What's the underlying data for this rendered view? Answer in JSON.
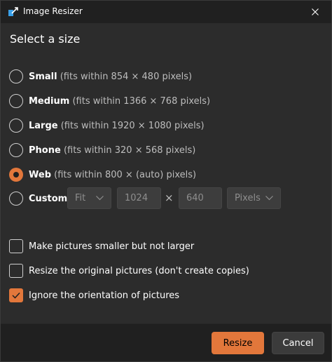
{
  "window": {
    "title": "Image Resizer",
    "icon": "image-resizer-icon",
    "close_icon": "close-icon"
  },
  "heading": "Select a size",
  "sizes": [
    {
      "name": "Small",
      "desc": "(fits within 854 × 480 pixels)",
      "checked": false
    },
    {
      "name": "Medium",
      "desc": "(fits within 1366 × 768 pixels)",
      "checked": false
    },
    {
      "name": "Large",
      "desc": "(fits within 1920 × 1080 pixels)",
      "checked": false
    },
    {
      "name": "Phone",
      "desc": "(fits within 320 × 568 pixels)",
      "checked": false
    },
    {
      "name": "Web",
      "desc": "(fits within 800 × (auto) pixels)",
      "checked": true
    },
    {
      "name": "Custom",
      "desc": "",
      "checked": false
    }
  ],
  "custom": {
    "fit_value": "Fit",
    "width_value": "1024",
    "times": "×",
    "height_value": "640",
    "unit_value": "Pixels"
  },
  "options": [
    {
      "label": "Make pictures smaller but not larger",
      "checked": false
    },
    {
      "label": "Resize the original pictures (don't create copies)",
      "checked": false
    },
    {
      "label": "Ignore the orientation of pictures",
      "checked": true
    }
  ],
  "buttons": {
    "resize": "Resize",
    "cancel": "Cancel"
  },
  "colors": {
    "accent": "#e2773b",
    "background": "#2c2c2c",
    "titlebar": "#202020"
  }
}
